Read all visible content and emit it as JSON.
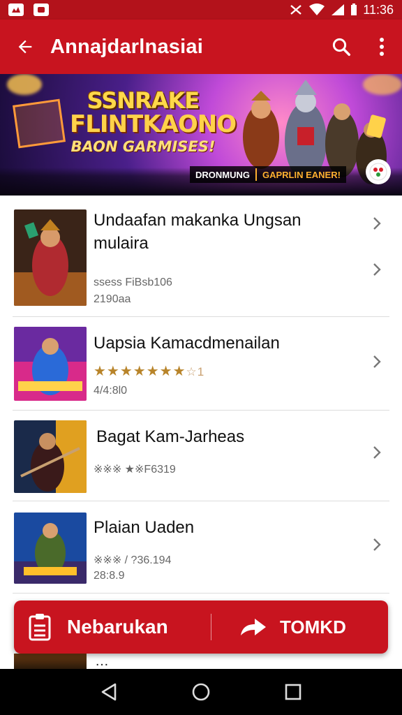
{
  "status_bar": {
    "time": "11:36",
    "icons": [
      "notification-icon",
      "notification-icon",
      "mute-icon",
      "wifi-icon",
      "signal-icon",
      "battery-icon"
    ]
  },
  "app_bar": {
    "title": "Annajdarlnasiai",
    "icons": [
      "back-arrow-icon",
      "search-icon",
      "more-vert-icon"
    ]
  },
  "banner": {
    "title_line1": "SSNRAKE",
    "title_line2": "FLINTKAONO",
    "title_line3": "BAON GARMISES!",
    "strip_left": "DRONMUNG",
    "strip_right": "GAPRLIN EANER!"
  },
  "list": {
    "items": [
      {
        "title": "Undaafan makanka Ungsan",
        "title2": "mulaira",
        "meta1": "ssess FiBsb106",
        "meta2": "2190aa"
      },
      {
        "title": "Uapsia Kamacdmenailan",
        "rating_stars": "★★★★★★★",
        "rating_extra": "☆1",
        "meta1": "4/4:8l0"
      },
      {
        "title": "Bagat Kam-Jarheas",
        "meta1": "※※※ ★※F6319"
      },
      {
        "title": "Plaian Uaden",
        "meta1": "※※※ / ?36.194",
        "meta2": "28:8.9"
      }
    ]
  },
  "action_bar": {
    "left_label": "Nebarukan",
    "right_label": "TOMKD",
    "icons": [
      "clipboard-list-icon",
      "share-arrow-icon"
    ]
  },
  "peek_item": {
    "title": "…"
  },
  "nav_bar": {
    "icons": [
      "nav-back-icon",
      "nav-home-icon",
      "nav-recents-icon"
    ]
  },
  "colors": {
    "primary": "#c8141f",
    "status": "#b3121b",
    "star": "#b8842a"
  }
}
